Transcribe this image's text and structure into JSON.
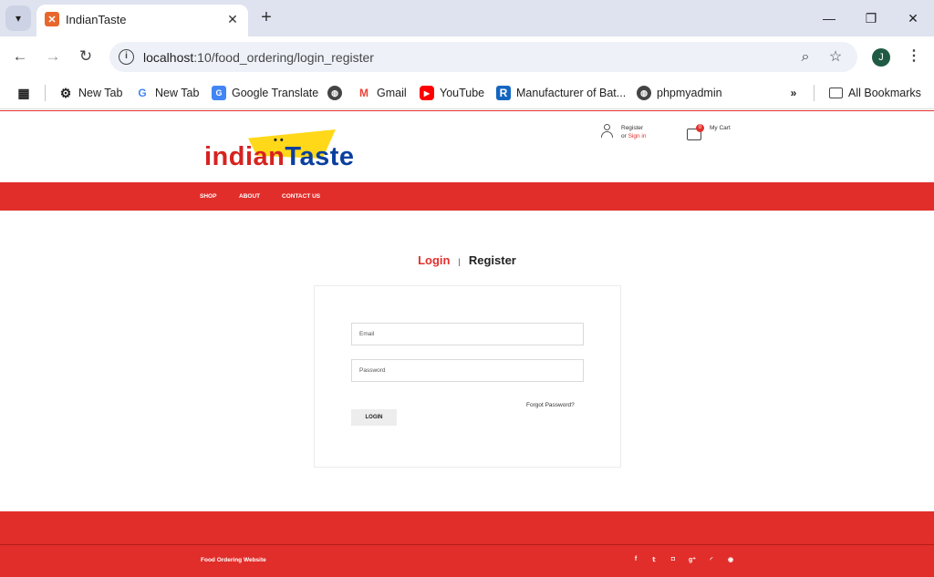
{
  "browser": {
    "tab_title": "IndianTaste",
    "url_host": "localhost",
    "url_path": ":10/food_ordering/login_register",
    "profile_initial": "J",
    "bookmarks": [
      {
        "label": "New Tab",
        "icon": "gear-icon"
      },
      {
        "label": "New Tab",
        "icon": "google-icon"
      },
      {
        "label": "Google Translate",
        "icon": "translate-icon"
      },
      {
        "label": "",
        "icon": "globe-icon"
      },
      {
        "label": "Gmail",
        "icon": "gmail-icon"
      },
      {
        "label": "YouTube",
        "icon": "youtube-icon"
      },
      {
        "label": "Manufacturer of Bat...",
        "icon": "r-icon"
      },
      {
        "label": "phpmyadmin",
        "icon": "globe-icon"
      }
    ],
    "all_bookmarks": "All Bookmarks"
  },
  "site": {
    "logo_part1": "indian",
    "logo_part2": "Taste",
    "account_line1": "Register",
    "account_or": "or ",
    "account_signin": "Sign in",
    "cart_count": "0",
    "cart_label": "My Cart",
    "nav": [
      "SHOP",
      "ABOUT",
      "CONTACT US"
    ]
  },
  "auth": {
    "login_tab": "Login",
    "divider": "|",
    "register_tab": "Register",
    "email_placeholder": "Email",
    "password_placeholder": "Password",
    "forgot": "Forgot Password?",
    "login_button": "LOGIN"
  },
  "footer": {
    "copy": "Food Ordering Website",
    "social": [
      "f",
      "t",
      "ig",
      "g+",
      "rss",
      "p"
    ]
  },
  "colors": {
    "brand_red": "#e12e2a",
    "logo_blue": "#0a3f9e",
    "logo_yellow": "#ffd81a"
  }
}
